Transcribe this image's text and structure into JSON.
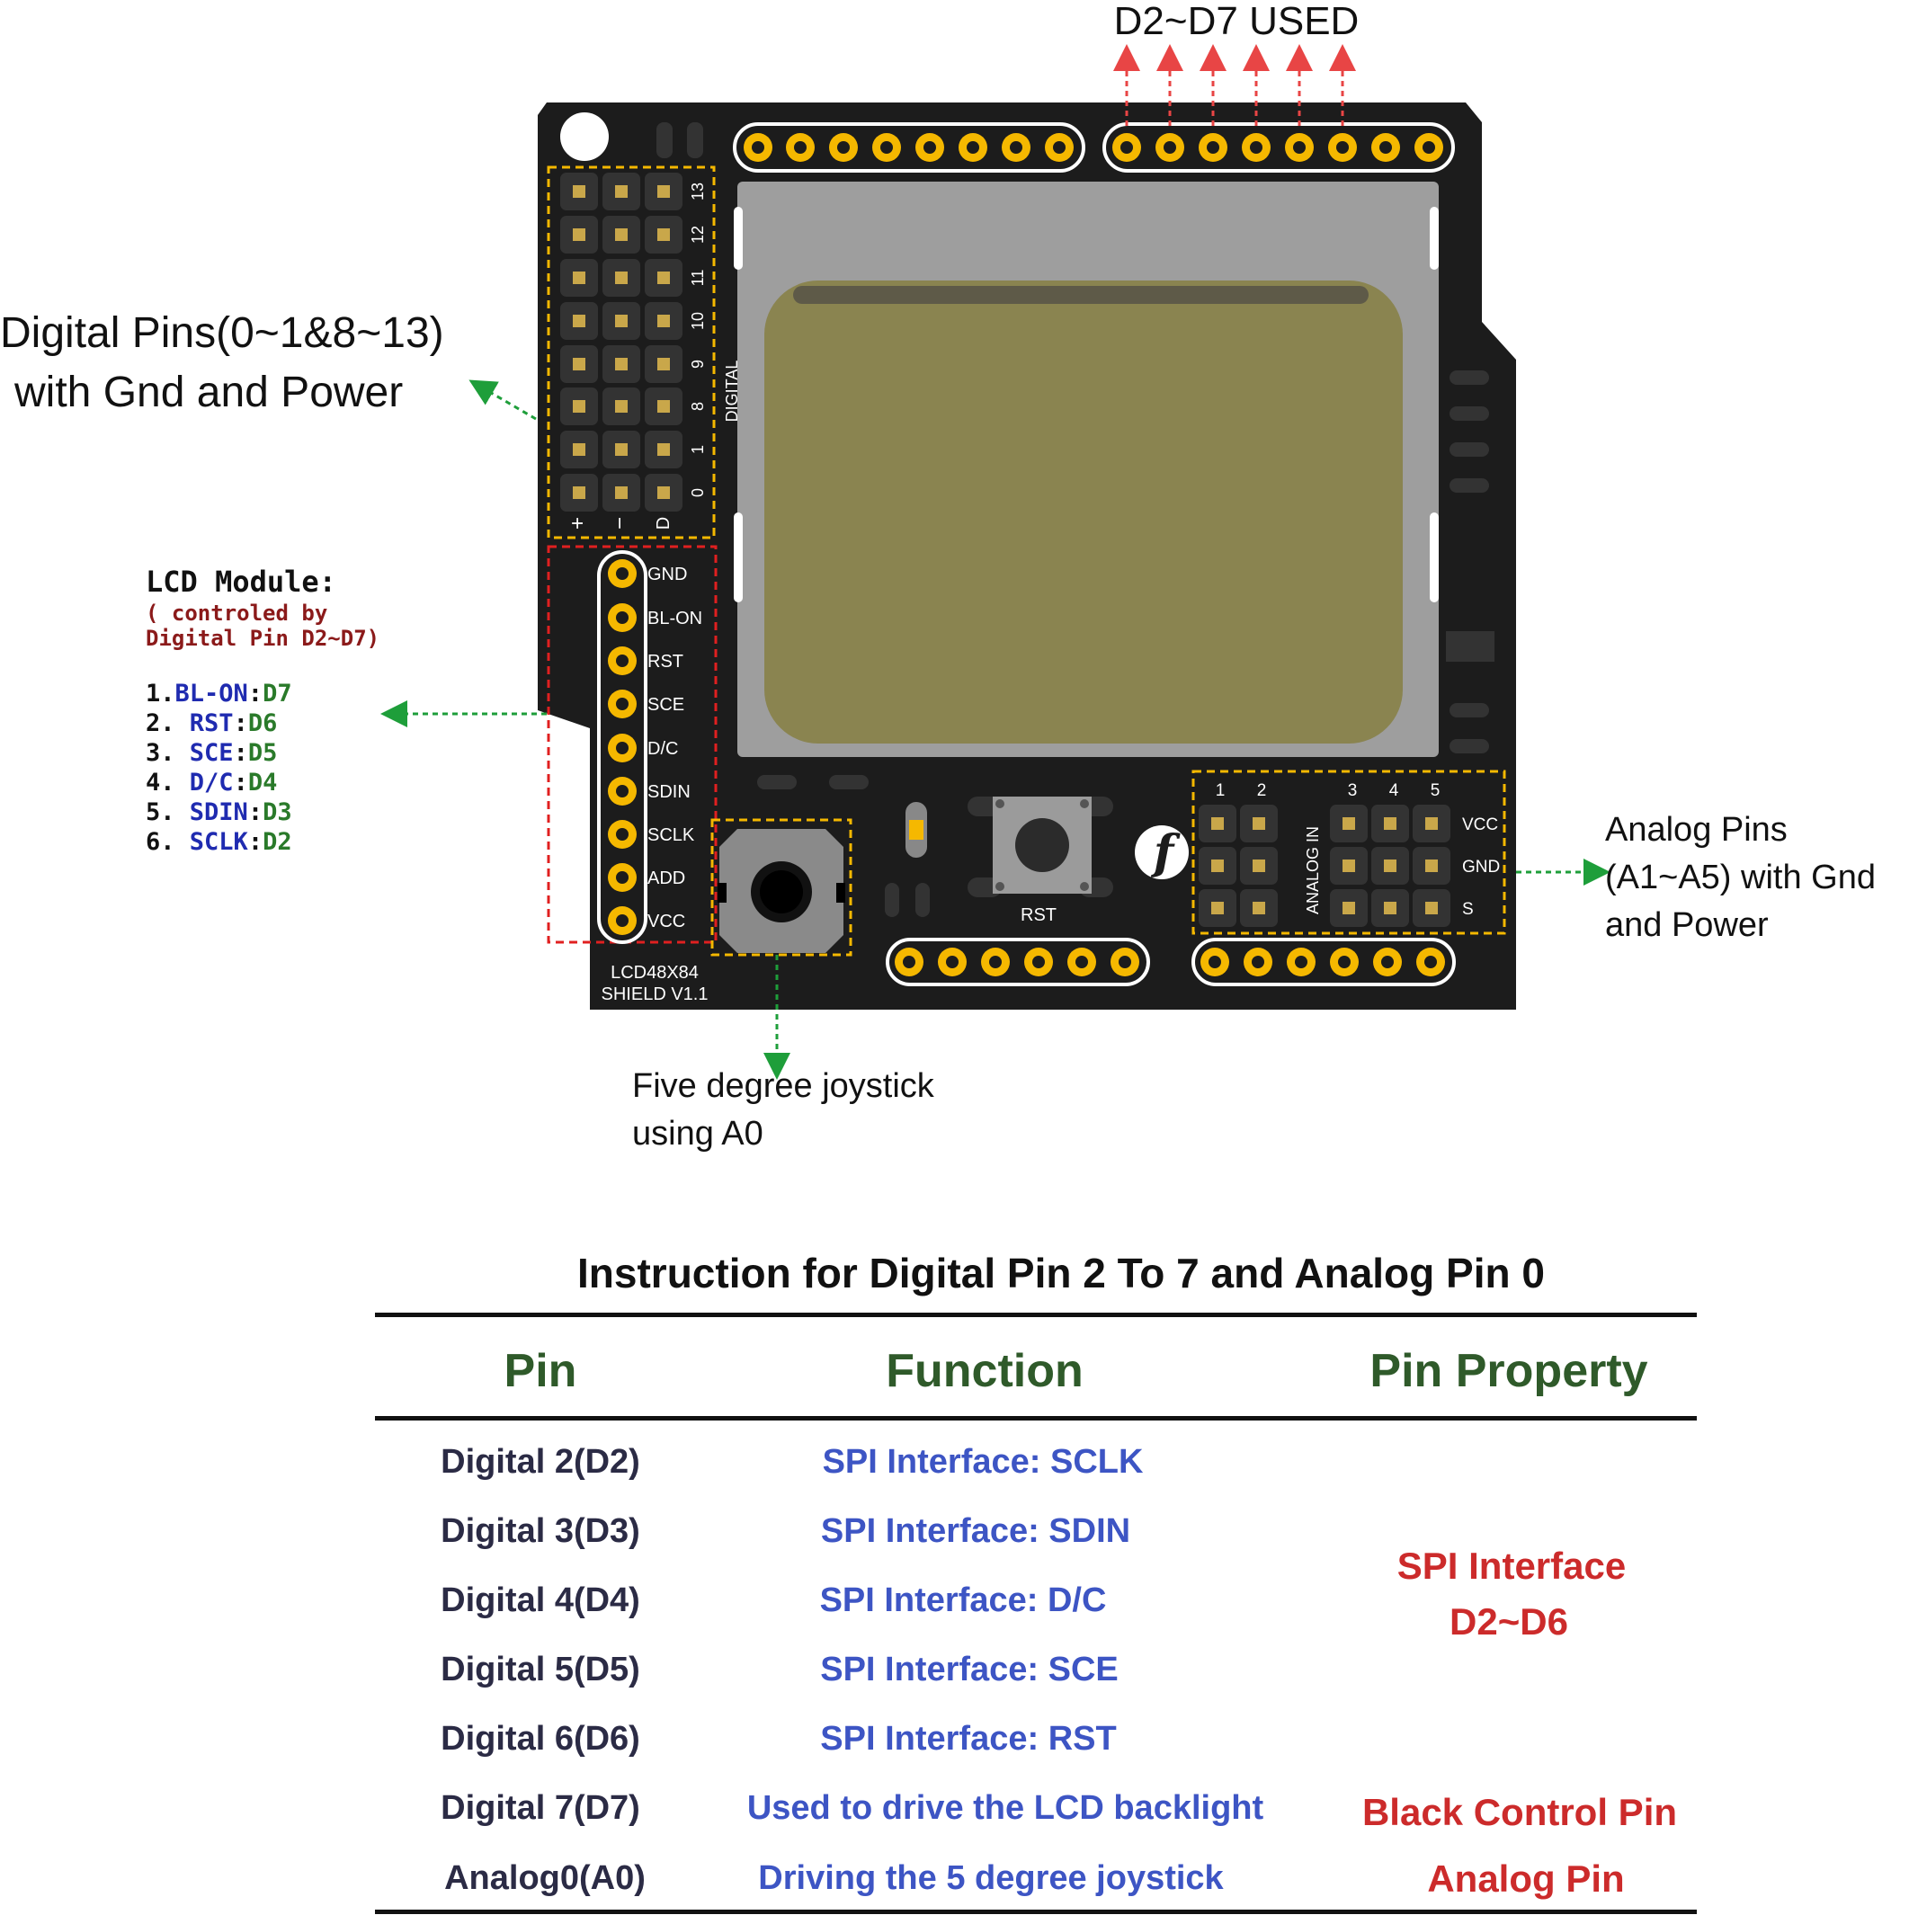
{
  "top_label": "D2~D7 USED",
  "callouts": {
    "digital_pins": [
      "Digital Pins(0~1&8~13)",
      "with Gnd and Power"
    ],
    "analog_pins": [
      "Analog Pins",
      "(A1~A5) with Gnd",
      "and Power"
    ],
    "joystick": [
      "Five degree joystick",
      "using A0"
    ]
  },
  "lcd_module": {
    "title": "LCD Module:",
    "subtitle": [
      "( controled by",
      "Digital Pin D2~D7)"
    ],
    "mapping": [
      {
        "num": "1.",
        "name": "BL-ON",
        "pin": "D7"
      },
      {
        "num": "2.",
        "name": "RST",
        "pin": "D6"
      },
      {
        "num": "3.",
        "name": "SCE",
        "pin": "D5"
      },
      {
        "num": "4.",
        "name": "D/C",
        "pin": "D4"
      },
      {
        "num": "5.",
        "name": "SDIN",
        "pin": "D3"
      },
      {
        "num": "6.",
        "name": "SCLK",
        "pin": "D2"
      }
    ]
  },
  "board": {
    "digital_header_numbers": [
      "13",
      "12",
      "11",
      "10",
      "9",
      "8",
      "1",
      "0"
    ],
    "digital_header_columns": [
      "+",
      "−",
      "D"
    ],
    "digital_label": "DIGITAL",
    "lcd_pins": [
      "GND",
      "BL-ON",
      "RST",
      "SCE",
      "D/C",
      "SDIN",
      "SCLK",
      "ADD",
      "VCC"
    ],
    "model": [
      "LCD48X84",
      "SHIELD V1.1"
    ],
    "reset_label": "RST",
    "analog_label": "ANALOG IN",
    "analog_numbers": [
      "1",
      "2",
      "3",
      "4",
      "5"
    ],
    "analog_rows": [
      "VCC",
      "GND",
      "S"
    ]
  },
  "table": {
    "title": "Instruction for Digital Pin 2 To 7 and Analog Pin 0",
    "headers": [
      "Pin",
      "Function",
      "Pin Property"
    ],
    "rows": [
      {
        "pin": "Digital 2(D2)",
        "function": "SPI Interface: SCLK"
      },
      {
        "pin": "Digital 3(D3)",
        "function": "SPI Interface: SDIN"
      },
      {
        "pin": "Digital 4(D4)",
        "function": "SPI Interface: D/C"
      },
      {
        "pin": "Digital 5(D5)",
        "function": "SPI Interface: SCE"
      },
      {
        "pin": "Digital 6(D6)",
        "function": "SPI Interface: RST"
      },
      {
        "pin": "Digital 7(D7)",
        "function": "Used to drive the LCD backlight"
      },
      {
        "pin": "Analog0(A0)",
        "function": "Driving the 5 degree joystick"
      }
    ],
    "property_spi": [
      "SPI Interface",
      "D2~D6"
    ],
    "property_d7": "Black Control Pin",
    "property_a0": "Analog Pin"
  },
  "colors": {
    "board": "#1c1c1c",
    "header_pin": "#f5b800",
    "lcd_screen": "#8a8450",
    "green_arrow": "#1e9e3a",
    "red_arrow": "#e84545",
    "table_header": "#2f5a2a",
    "table_pin": "#2b2b45",
    "table_function": "#3d55c4",
    "table_property": "#cc2b2b",
    "mono_name": "#1f2bb0",
    "mono_pin": "#2a7a2a",
    "mono_subtitle": "#8b1a1a"
  }
}
